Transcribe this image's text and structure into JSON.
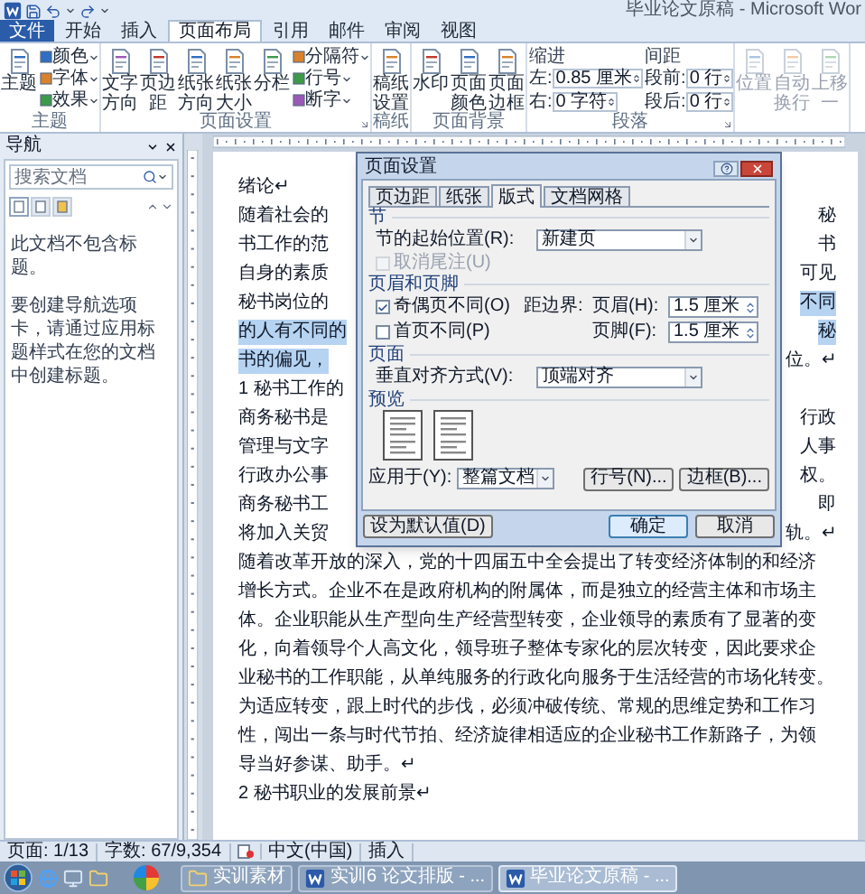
{
  "title_bar": {
    "title": "毕业论文原稿 - Microsoft Wor"
  },
  "ribbon_tabs": [
    {
      "label": "文件",
      "kind": "file",
      "selected": false
    },
    {
      "label": "开始",
      "kind": "tab",
      "selected": false
    },
    {
      "label": "插入",
      "kind": "tab",
      "selected": false
    },
    {
      "label": "页面布局",
      "kind": "tab",
      "selected": true
    },
    {
      "label": "引用",
      "kind": "tab",
      "selected": false
    },
    {
      "label": "邮件",
      "kind": "tab",
      "selected": false
    },
    {
      "label": "审阅",
      "kind": "tab",
      "selected": false
    },
    {
      "label": "视图",
      "kind": "tab",
      "selected": false
    }
  ],
  "ribbon_groups": [
    {
      "label": "主题",
      "launcher": false,
      "items": [
        {
          "kind": "large",
          "label": "主题",
          "disabled": false
        },
        {
          "kind": "stack",
          "entries": [
            "颜色",
            "字体",
            "效果"
          ]
        }
      ]
    },
    {
      "label": "页面设置",
      "launcher": true,
      "items": [
        {
          "kind": "large",
          "label": "文字方向",
          "disabled": false
        },
        {
          "kind": "large",
          "label": "页边距",
          "disabled": false
        },
        {
          "kind": "large",
          "label": "纸张方向",
          "disabled": false
        },
        {
          "kind": "large",
          "label": "纸张大小",
          "disabled": false
        },
        {
          "kind": "large",
          "label": "分栏",
          "disabled": false
        },
        {
          "kind": "stack",
          "entries": [
            "分隔符",
            "行号",
            "断字"
          ]
        }
      ]
    },
    {
      "label": "稿纸",
      "launcher": false,
      "items": [
        {
          "kind": "large",
          "label": "稿纸设置",
          "disabled": false
        }
      ]
    },
    {
      "label": "页面背景",
      "launcher": false,
      "items": [
        {
          "kind": "large",
          "label": "水印",
          "disabled": false
        },
        {
          "kind": "large",
          "label": "页面颜色",
          "disabled": false
        },
        {
          "kind": "large",
          "label": "页面边框",
          "disabled": false
        }
      ]
    },
    {
      "label": "段落",
      "launcher": true,
      "items": [
        {
          "kind": "spins",
          "heading": "缩进",
          "rows": [
            {
              "label": "左:",
              "value": "0.85 厘米"
            },
            {
              "label": "右:",
              "value": "0 字符"
            }
          ]
        },
        {
          "kind": "spins",
          "heading": "间距",
          "rows": [
            {
              "label": "段前:",
              "value": "0 行"
            },
            {
              "label": "段后:",
              "value": "0 行"
            }
          ]
        }
      ]
    },
    {
      "launcher": false,
      "items": [
        {
          "kind": "large",
          "label": "位置",
          "disabled": true
        },
        {
          "kind": "large",
          "label": "自动换行",
          "disabled": true
        },
        {
          "kind": "large",
          "label": "上移一",
          "disabled": true
        }
      ]
    }
  ],
  "navigation": {
    "title": "导航",
    "search": {
      "placeholder": "搜索文档"
    },
    "tabs": [
      {
        "selected": true
      },
      {
        "selected": false
      },
      {
        "selected": false
      }
    ],
    "message": "此文档不包含标题。",
    "hint": "要创建导航选项卡，请通过应用标题样式在您的文档中创建标题。"
  },
  "document": {
    "lines": [
      {
        "kind": "full",
        "parts": [
          {
            "text": "绪论↵",
            "selected": false
          }
        ]
      },
      {
        "kind": "split",
        "parts": [
          {
            "text": "随着社会的",
            "selected": false
          },
          {
            "text": "秘",
            "selected": false
          }
        ]
      },
      {
        "kind": "split",
        "parts": [
          {
            "text": "书工作的范",
            "selected": false
          },
          {
            "text": "书",
            "selected": false
          }
        ]
      },
      {
        "kind": "split",
        "parts": [
          {
            "text": "自身的素质",
            "selected": false
          },
          {
            "text": "可见",
            "selected": false
          }
        ]
      },
      {
        "kind": "split",
        "parts": [
          {
            "text": "秘书岗位的",
            "selected": false
          },
          {
            "text": "不同",
            "selected": true
          }
        ]
      },
      {
        "kind": "split",
        "parts": [
          {
            "text": "的人有不同的",
            "selected": true
          },
          {
            "text": "秘",
            "selected": true
          }
        ]
      },
      {
        "kind": "split",
        "parts": [
          {
            "text": "书的偏见，",
            "selected": true
          },
          {
            "text": "位。↵",
            "selected": false
          }
        ]
      },
      {
        "kind": "split",
        "parts": [
          {
            "text": "1 秘书工作的",
            "selected": false
          }
        ]
      },
      {
        "kind": "split",
        "parts": [
          {
            "text": "商务秘书是",
            "selected": false
          },
          {
            "text": "行政",
            "selected": false
          }
        ]
      },
      {
        "kind": "split",
        "parts": [
          {
            "text": "管理与文字",
            "selected": false
          },
          {
            "text": "人事",
            "selected": false
          }
        ]
      },
      {
        "kind": "split",
        "parts": [
          {
            "text": "行政办公事",
            "selected": false
          },
          {
            "text": "权。",
            "selected": false
          }
        ]
      },
      {
        "kind": "split",
        "parts": [
          {
            "text": "商务秘书工",
            "selected": false
          },
          {
            "text": "即",
            "selected": false
          }
        ]
      },
      {
        "kind": "split",
        "parts": [
          {
            "text": "将加入关贸",
            "selected": false
          },
          {
            "text": "轨。↵",
            "selected": false
          }
        ]
      },
      {
        "kind": "full",
        "parts": [
          {
            "text": "随着改革开放的深入，党的十四届五中全会提出了转变经济体制的和经济",
            "selected": false
          }
        ]
      },
      {
        "kind": "full",
        "parts": [
          {
            "text": "增长方式。企业不在是政府机构的附属体，而是独立的经营主体和市场主",
            "selected": false
          }
        ]
      },
      {
        "kind": "full",
        "parts": [
          {
            "text": "体。企业职能从生产型向生产经营型转变，企业领导的素质有了显著的变",
            "selected": false
          }
        ]
      },
      {
        "kind": "full",
        "parts": [
          {
            "text": "化，向着领导个人高文化，领导班子整体专家化的层次转变，因此要求企",
            "selected": false
          }
        ]
      },
      {
        "kind": "full",
        "parts": [
          {
            "text": "业秘书的工作职能，从单纯服务的行政化向服务于生活经营的市场化转变。",
            "selected": false
          }
        ]
      },
      {
        "kind": "full",
        "parts": [
          {
            "text": "为适应转变，跟上时代的步伐，必须冲破传统、常规的思维定势和工作习",
            "selected": false
          }
        ]
      },
      {
        "kind": "full",
        "parts": [
          {
            "text": "性，闯出一条与时代节拍、经济旋律相适应的企业秘书工作新路子，为领",
            "selected": false
          }
        ]
      },
      {
        "kind": "full",
        "parts": [
          {
            "text": "导当好参谋、助手。↵",
            "selected": false
          }
        ]
      },
      {
        "kind": "full",
        "parts": [
          {
            "text": "2 秘书职业的发展前景↵",
            "selected": false
          }
        ]
      }
    ]
  },
  "dialog": {
    "title": "页面设置",
    "tabs": [
      {
        "label": "页边距",
        "selected": false
      },
      {
        "label": "纸张",
        "selected": false
      },
      {
        "label": "版式",
        "selected": true
      },
      {
        "label": "文档网格",
        "selected": false
      }
    ],
    "section": {
      "heading": "节",
      "start_label": "节的起始位置(R):",
      "start_value": "新建页",
      "suppress_endnotes": {
        "label": "取消尾注(U)",
        "checked": false,
        "disabled": true
      }
    },
    "headers_footers": {
      "heading": "页眉和页脚",
      "odd_even": {
        "label": "奇偶页不同(O)",
        "checked": true,
        "disabled": false
      },
      "first_page": {
        "label": "首页不同(P)",
        "checked": false,
        "disabled": false
      },
      "from_edge_label": "距边界:",
      "header": {
        "label": "页眉(H):",
        "value": "1.5 厘米"
      },
      "footer": {
        "label": "页脚(F):",
        "value": "1.5 厘米"
      }
    },
    "page": {
      "heading": "页面",
      "valign_label": "垂直对齐方式(V):",
      "valign_value": "顶端对齐"
    },
    "preview": {
      "heading": "预览",
      "apply_label": "应用于(Y):",
      "apply_value": "整篇文档",
      "line_numbers_button": "行号(N)...",
      "borders_button": "边框(B)..."
    },
    "buttons": {
      "default": "设为默认值(D)",
      "ok": "确定",
      "cancel": "取消"
    }
  },
  "status_bar": {
    "page": "页面: 1/13",
    "words": "字数: 67/9,354",
    "language": "中文(中国)",
    "mode": "插入"
  },
  "taskbar": {
    "windows": [
      {
        "label": "实训素材",
        "kind": "folder",
        "selected": false
      },
      {
        "label": "实训6 论文排版 - ...",
        "kind": "word",
        "selected": false
      },
      {
        "label": "毕业论文原稿 - ...",
        "kind": "word",
        "selected": true
      }
    ]
  }
}
